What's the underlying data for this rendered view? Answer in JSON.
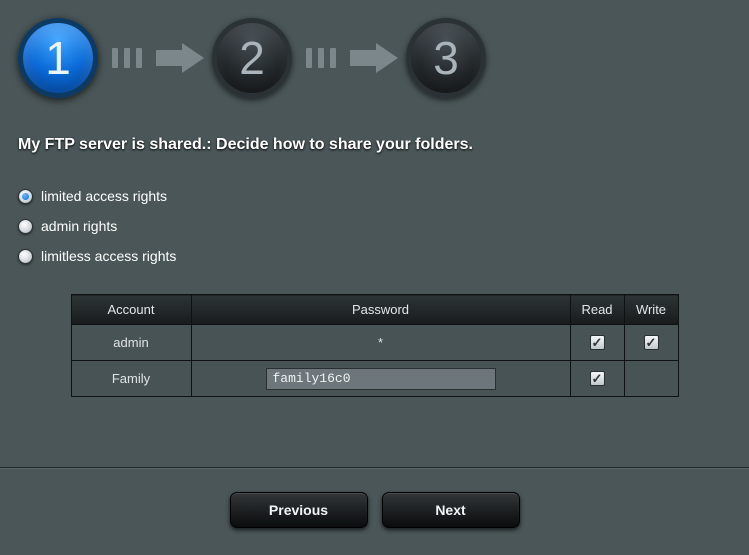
{
  "steps": {
    "s1": "1",
    "s2": "2",
    "s3": "3",
    "active_index": 0
  },
  "title": "My FTP server is shared.: Decide how to share your folders.",
  "radios": {
    "r0": "limited access rights",
    "r1": "admin rights",
    "r2": "limitless access rights",
    "selected": 0
  },
  "table": {
    "headers": {
      "account": "Account",
      "password": "Password",
      "read": "Read",
      "write": "Write"
    },
    "rows": {
      "row0": {
        "account": "admin",
        "password_display": "*",
        "read": true,
        "write": true,
        "editable": false
      },
      "row1": {
        "account": "Family",
        "password_value": "family16c0",
        "read": true,
        "write": false,
        "editable": true
      }
    }
  },
  "buttons": {
    "previous": "Previous",
    "next": "Next"
  }
}
